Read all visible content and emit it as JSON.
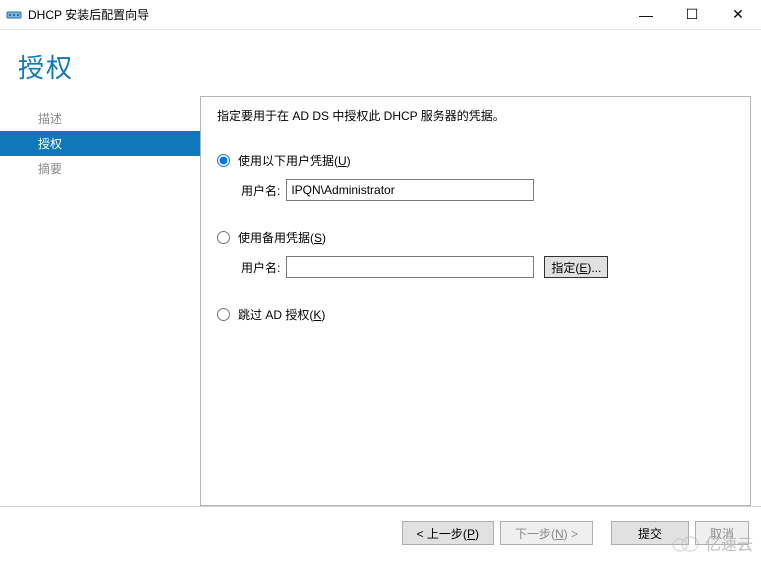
{
  "window": {
    "title": "DHCP 安装后配置向导",
    "controls": {
      "min": "—",
      "max": "☐",
      "close": "✕"
    }
  },
  "page": {
    "title": "授权"
  },
  "sidebar": {
    "items": [
      {
        "label": "描述",
        "active": false
      },
      {
        "label": "授权",
        "active": true
      },
      {
        "label": "摘要",
        "active": false
      }
    ]
  },
  "content": {
    "instruction": "指定要用于在 AD DS 中授权此 DHCP 服务器的凭据。",
    "option1": {
      "prefix": "使用以下用户凭据(",
      "accel": "U",
      "suffix": ")"
    },
    "option2": {
      "prefix": "使用备用凭据(",
      "accel": "S",
      "suffix": ")"
    },
    "option3": {
      "prefix": "跳过 AD 授权(",
      "accel": "K",
      "suffix": ")"
    },
    "userLabel": "用户名:",
    "userValue1": "IPQN\\Administrator",
    "userValue2": "",
    "specifyBtn": {
      "prefix": "指定(",
      "accel": "E",
      "suffix": ")..."
    }
  },
  "footer": {
    "back": {
      "left": "< 上一步(",
      "accel": "P",
      "right": ")"
    },
    "next": {
      "left": "下一步(",
      "accel": "N",
      "right": ") >"
    },
    "commit": "提交",
    "cancel": "取消"
  },
  "watermark": "亿速云"
}
